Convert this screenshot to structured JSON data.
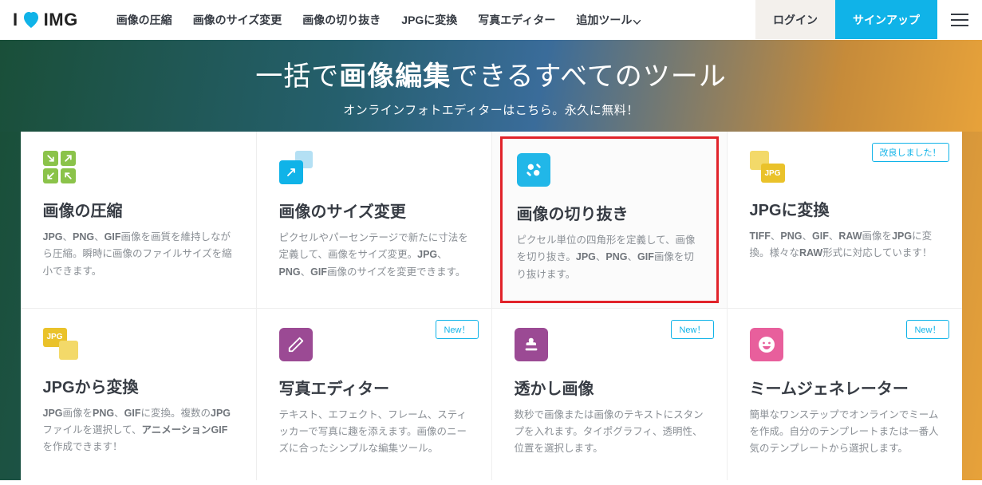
{
  "logo": {
    "prefix": "I",
    "suffix": "IMG"
  },
  "nav": {
    "items": [
      "画像の圧縮",
      "画像のサイズ変更",
      "画像の切り抜き",
      "JPGに変換",
      "写真エディター"
    ],
    "more": "追加ツール"
  },
  "auth": {
    "login": "ログイン",
    "signup": "サインアップ"
  },
  "hero": {
    "title_pre": "一括で",
    "title_bold": "画像編集",
    "title_post": "できるすべてのツール",
    "subtitle": "オンラインフォトエディターはこちら。永久に無料！"
  },
  "badges": {
    "new": "New！",
    "improved": "改良しました！"
  },
  "tools": [
    {
      "title": "画像の圧縮",
      "desc_html": "<b>JPG</b>、<b>PNG</b>、<b>GIF</b>画像を画質を維持しながら圧縮。瞬時に画像のファイルサイズを縮小できます。"
    },
    {
      "title": "画像のサイズ変更",
      "desc_html": "ピクセルやパーセンテージで新たに寸法を定義して、画像をサイズ変更。<b>JPG</b>、<b>PNG</b>、<b>GIF</b>画像のサイズを変更できます。"
    },
    {
      "title": "画像の切り抜き",
      "desc_html": "ピクセル単位の四角形を定義して、画像を切り抜き。<b>JPG</b>、<b>PNG</b>、<b>GIF</b>画像を切り抜けます。"
    },
    {
      "title": "JPGに変換",
      "desc_html": "<b>TIFF</b>、<b>PNG</b>、<b>GIF</b>、<b>RAW</b>画像を<b>JPG</b>に変換。様々な<b>RAW</b>形式に対応しています！"
    },
    {
      "title": "JPGから変換",
      "desc_html": "<b>JPG</b>画像を<b>PNG</b>、<b>GIF</b>に変換。複数の<b>JPG</b>ファイルを選択して、<b>アニメーションGIF</b>を作成できます！"
    },
    {
      "title": "写真エディター",
      "desc_html": "テキスト、エフェクト、フレーム、スティッカーで写真に趣を添えます。画像のニーズに合ったシンプルな編集ツール。"
    },
    {
      "title": "透かし画像",
      "desc_html": "数秒で画像または画像のテキストにスタンプを入れます。タイポグラフィ、透明性、位置を選択します。"
    },
    {
      "title": "ミームジェネレーター",
      "desc_html": "簡単なワンステップでオンラインでミームを作成。自分のテンプレートまたは一番人気のテンプレートから選択します。"
    }
  ],
  "jpg_label": "JPG"
}
